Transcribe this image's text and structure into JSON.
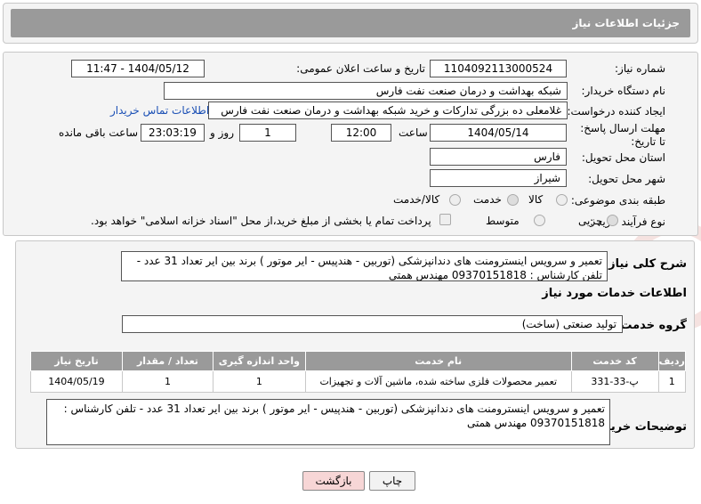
{
  "header": {
    "title": "جزئیات اطلاعات نیاز"
  },
  "fields": {
    "need_number": {
      "label": "شماره نیاز:",
      "value": "1104092113000524"
    },
    "announce_datetime": {
      "label": "تاریخ و ساعت اعلان عمومی:",
      "value": "1404/05/12 - 11:47"
    },
    "buyer_org": {
      "label": "نام دستگاه خریدار:",
      "value": "شبکه بهداشت و درمان صنعت نفت فارس"
    },
    "requester": {
      "label": "ایجاد کننده درخواست:",
      "value": "غلامعلی ده بزرگی تدارکات و خرید شبکه بهداشت و درمان صنعت نفت فارس",
      "contact_link": "اطلاعات تماس خریدار"
    },
    "deadline": {
      "label": "مهلت ارسال پاسخ: تا تاریخ:",
      "date": "1404/05/14",
      "time_label": "ساعت",
      "time": "12:00",
      "days": "1",
      "days_label": "روز و",
      "remaining": "23:03:19",
      "remaining_label": "ساعت باقی مانده"
    },
    "province": {
      "label": "استان محل تحویل:",
      "value": "فارس"
    },
    "city": {
      "label": "شهر محل تحویل:",
      "value": "شیراز"
    },
    "category": {
      "label": "طبقه بندی موضوعی:",
      "options": [
        "کالا",
        "خدمت",
        "کالا/خدمت"
      ],
      "selected": "خدمت"
    },
    "process": {
      "label": "نوع فرآیند خرید :",
      "options": [
        "جزیی",
        "متوسط"
      ],
      "selected": "جزیی",
      "payment_note": "پرداخت تمام یا بخشی از مبلغ خرید،از محل \"اسناد خزانه اسلامی\" خواهد بود."
    }
  },
  "summary": {
    "label": "شرح کلی نیاز:",
    "text": "تعمیر و سرویس اینسترومنت های دندانپزشکی (توربین - هندپیس - ایر موتور ) برند بین ایر تعداد 31 عدد - تلفن کارشناس : 09370151818 مهندس همتی"
  },
  "services": {
    "section_title": "اطلاعات خدمات مورد نیاز",
    "group_label": "گروه خدمت:",
    "group_value": "تولید صنعتی (ساخت)",
    "columns": [
      "ردیف",
      "کد خدمت",
      "نام خدمت",
      "واحد اندازه گیری",
      "تعداد / مقدار",
      "تاریخ نیاز"
    ],
    "rows": [
      [
        "1",
        "پ-33-331",
        "تعمیر محصولات فلزی ساخته شده، ماشین آلات و تجهیزات",
        "1",
        "1",
        "1404/05/19"
      ]
    ]
  },
  "buyer_notes": {
    "label": "توضیحات خریدار:",
    "text": "تعمیر و سرویس اینسترومنت های دندانپزشکی (توربین - هندپیس - ایر موتور ) برند بین ایر تعداد 31 عدد - تلفن کارشناس : 09370151818 مهندس همتی"
  },
  "buttons": {
    "print": "چاپ",
    "back": "بازگشت"
  },
  "colors": {
    "header_bg": "#9a9a9a",
    "back_button_bg": "#f7d6d6",
    "link": "#1a4fb5"
  }
}
